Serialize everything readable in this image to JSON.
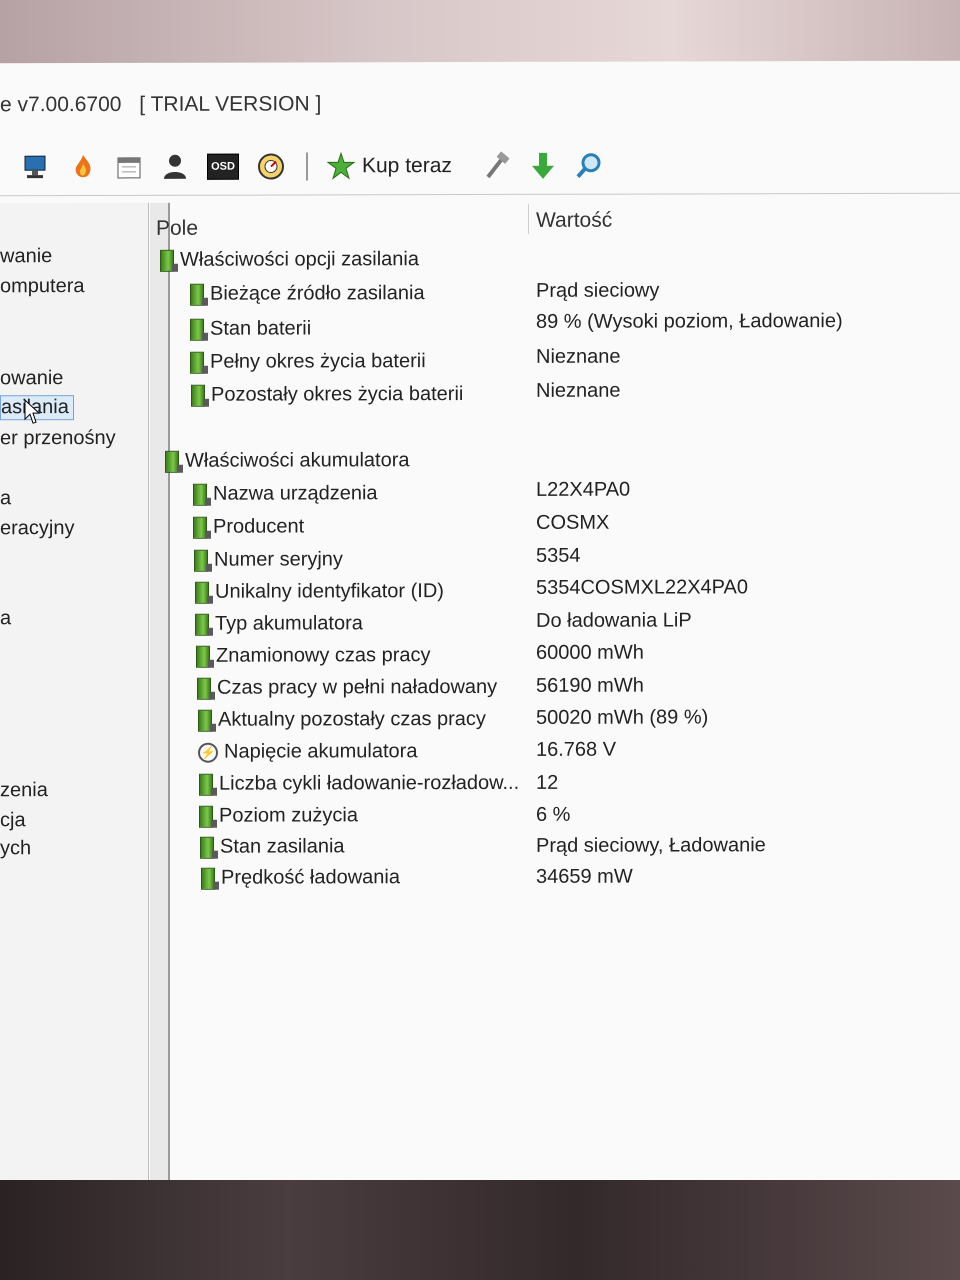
{
  "window": {
    "title_version": "e v7.00.6700",
    "title_trial": "[ TRIAL VERSION ]"
  },
  "toolbar": {
    "buy_label": "Kup teraz",
    "icons": [
      "network-icon",
      "fire-icon",
      "calendar-icon",
      "user-icon",
      "osd-icon",
      "gauge-icon",
      "star-icon",
      "tools-icon",
      "download-arrow-icon",
      "magnifier-icon"
    ],
    "osd_text": "OSD"
  },
  "sidebar": {
    "items": [
      {
        "label": "wanie"
      },
      {
        "label": "omputera"
      },
      {
        "label": "owanie"
      },
      {
        "label": "asilania"
      },
      {
        "label": "er przenośny"
      },
      {
        "label": "a"
      },
      {
        "label": "eracyjny"
      },
      {
        "label": "a"
      },
      {
        "label": "zenia"
      },
      {
        "label": "cja"
      },
      {
        "label": "ych"
      }
    ]
  },
  "table": {
    "col_field": "Pole",
    "col_value": "Wartość",
    "groups": [
      {
        "title": "Właściwości opcji zasilania",
        "rows": [
          {
            "field": "Bieżące źródło zasilania",
            "value": "Prąd sieciowy"
          },
          {
            "field": "Stan baterii",
            "value": "89 % (Wysoki poziom, Ładowanie)"
          },
          {
            "field": "Pełny okres życia baterii",
            "value": "Nieznane"
          },
          {
            "field": "Pozostały okres życia baterii",
            "value": "Nieznane"
          }
        ]
      },
      {
        "title": "Właściwości akumulatora",
        "rows": [
          {
            "field": "Nazwa urządzenia",
            "value": "L22X4PA0"
          },
          {
            "field": "Producent",
            "value": "COSMX"
          },
          {
            "field": "Numer seryjny",
            "value": "5354"
          },
          {
            "field": "Unikalny identyfikator (ID)",
            "value": "5354COSMXL22X4PA0"
          },
          {
            "field": "Typ akumulatora",
            "value": "Do ładowania LiP"
          },
          {
            "field": "Znamionowy czas pracy",
            "value": "60000 mWh"
          },
          {
            "field": "Czas pracy w pełni naładowany",
            "value": "56190 mWh"
          },
          {
            "field": "Aktualny pozostały czas pracy",
            "value": "50020 mWh  (89 %)"
          },
          {
            "field": "Napięcie akumulatora",
            "value": "16.768 V"
          },
          {
            "field": "Liczba cykli ładowanie-rozładow...",
            "value": "12"
          },
          {
            "field": "Poziom zużycia",
            "value": "6 %"
          },
          {
            "field": "Stan zasilania",
            "value": "Prąd sieciowy, Ładowanie"
          },
          {
            "field": "Prędkość ładowania",
            "value": "34659 mW"
          }
        ]
      }
    ]
  }
}
